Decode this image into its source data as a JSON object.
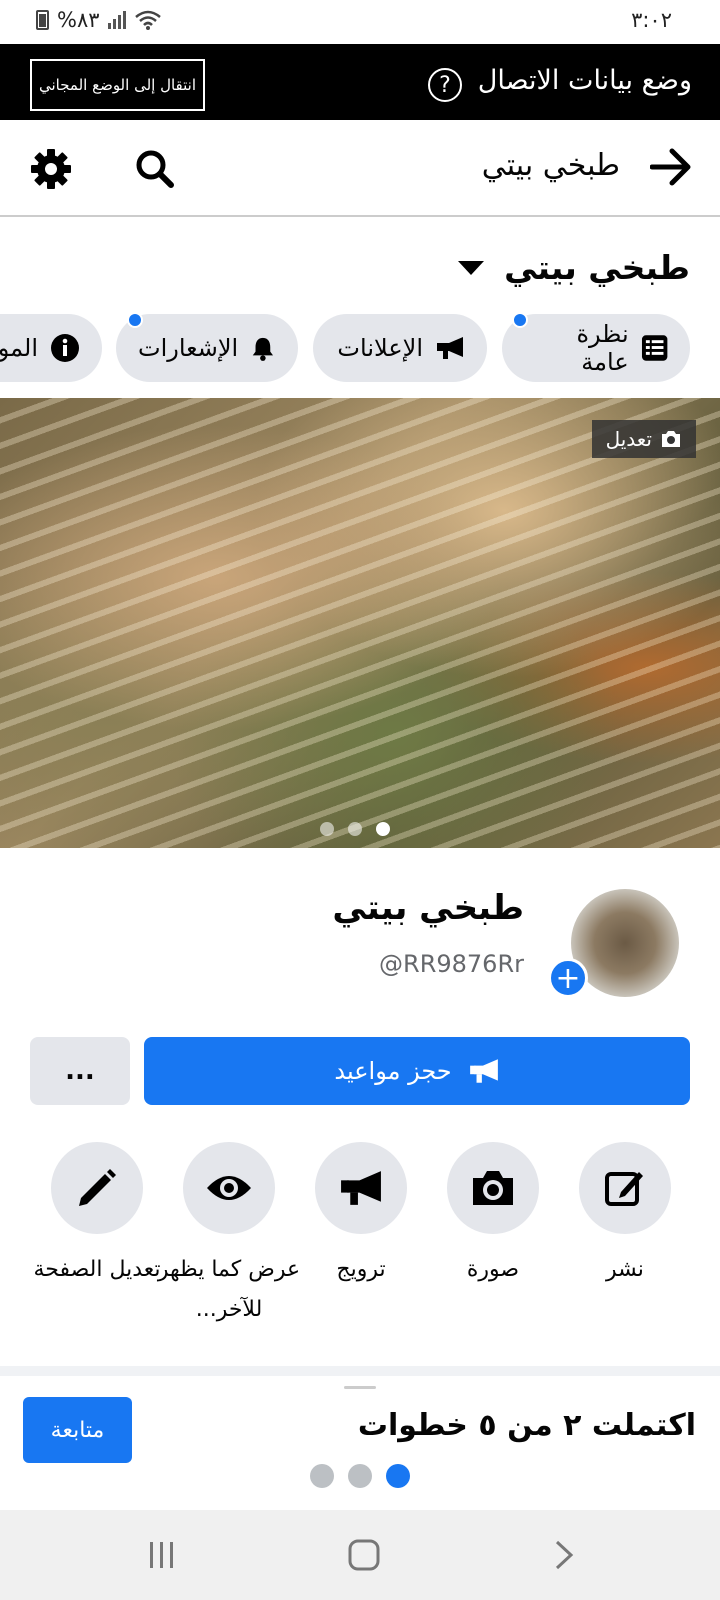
{
  "status_bar": {
    "battery": "%٨٣",
    "time": "٣:٠٢"
  },
  "data_mode": {
    "title": "وضع بيانات الاتصال",
    "free_mode_button": "انتقال إلى الوضع المجاني",
    "help_icon": "?"
  },
  "header": {
    "title": "طبخي بيتي"
  },
  "page_selector": {
    "label": "طبخي بيتي"
  },
  "tabs": [
    {
      "label": "نظرة عامة",
      "icon": "list-icon",
      "has_dot": true
    },
    {
      "label": "الإعلانات",
      "icon": "megaphone-icon",
      "has_dot": false
    },
    {
      "label": "الإشعارات",
      "icon": "bell-icon",
      "has_dot": true
    },
    {
      "label": "المو",
      "icon": "info-icon",
      "has_dot": false
    }
  ],
  "cover": {
    "edit_label": "تعديل",
    "slide_count": 3,
    "active_slide": 3
  },
  "profile": {
    "name": "طبخي بيتي",
    "handle": "@RR9876Rr",
    "add_icon": "+"
  },
  "actions": {
    "cta_label": "حجز مواعيد",
    "more_label": "..."
  },
  "quick_actions": [
    {
      "label": "نشر",
      "icon": "compose-icon"
    },
    {
      "label": "صورة",
      "icon": "camera-icon"
    },
    {
      "label": "ترويج",
      "icon": "megaphone-icon"
    },
    {
      "label": "عرض كما يظهر للآخر...",
      "icon": "eye-icon"
    },
    {
      "label": "تعديل الصفحة",
      "icon": "pencil-icon"
    }
  ],
  "setup_sheet": {
    "title": "اكتملت ٢ من ٥ خطوات",
    "continue_label": "متابعة",
    "progress_dots": 3,
    "active_dot": 1
  },
  "colors": {
    "accent": "#1877f2",
    "chip_bg": "#e4e6eb",
    "data_bar": "#000000"
  }
}
